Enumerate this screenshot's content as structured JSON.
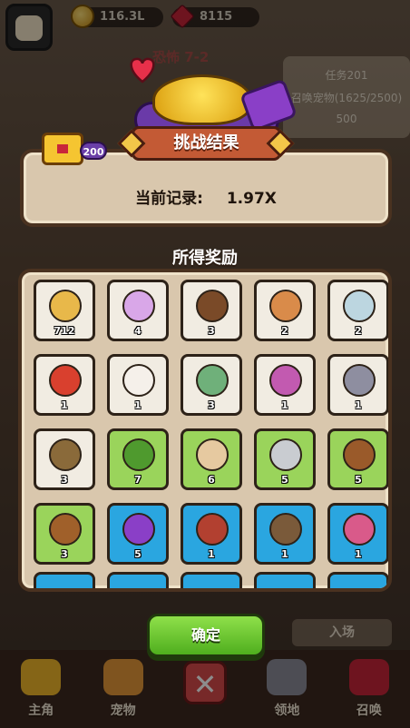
{
  "hud": {
    "gold": "116.3L",
    "gems": "8115",
    "stage": "恐怖 7-2"
  },
  "quest": {
    "title": "任务201",
    "desc": "召唤宠物(1625/2500)",
    "reward": "500"
  },
  "background_enter": "入场",
  "chest_badge": "200",
  "dialog": {
    "title": "挑战结果",
    "record_label": "当前记录:",
    "record_value": "1.97X",
    "rewards_title": "所得奖励",
    "confirm": "确定"
  },
  "rewards": [
    {
      "name": "green-gem-hexagon",
      "count": "712",
      "rarity": "white",
      "color": "#e8b84a"
    },
    {
      "name": "pink-shell",
      "count": "4",
      "rarity": "white",
      "color": "#d9a7e8"
    },
    {
      "name": "coconut",
      "count": "3",
      "rarity": "white",
      "color": "#7a4a28"
    },
    {
      "name": "cracked-egg",
      "count": "2",
      "rarity": "white",
      "color": "#d98b4a"
    },
    {
      "name": "swirl-egg",
      "count": "2",
      "rarity": "white",
      "color": "#bcd6e0"
    },
    {
      "name": "red-dragon",
      "count": "1",
      "rarity": "white",
      "color": "#d9402e"
    },
    {
      "name": "ghost-lollipop",
      "count": "1",
      "rarity": "white",
      "color": "#f5f0ea"
    },
    {
      "name": "green-fish",
      "count": "3",
      "rarity": "white",
      "color": "#6fb07a"
    },
    {
      "name": "purple-bird",
      "count": "1",
      "rarity": "white",
      "color": "#c25ab0"
    },
    {
      "name": "grey-mouse",
      "count": "1",
      "rarity": "white",
      "color": "#8e8ea0"
    },
    {
      "name": "snail",
      "count": "3",
      "rarity": "white",
      "color": "#8a6a3a"
    },
    {
      "name": "green-swirl-ball",
      "count": "7",
      "rarity": "green",
      "color": "#4f9a2e"
    },
    {
      "name": "feather",
      "count": "6",
      "rarity": "green",
      "color": "#e6c9a0"
    },
    {
      "name": "silver-shield",
      "count": "5",
      "rarity": "green",
      "color": "#c9ccd1"
    },
    {
      "name": "wooden-wheel",
      "count": "5",
      "rarity": "green",
      "color": "#9a5a2a"
    },
    {
      "name": "treasure-box",
      "count": "3",
      "rarity": "green",
      "color": "#a0602a"
    },
    {
      "name": "purple-bat",
      "count": "5",
      "rarity": "blue",
      "color": "#8a3fc7"
    },
    {
      "name": "red-warrior",
      "count": "1",
      "rarity": "blue",
      "color": "#b24030"
    },
    {
      "name": "mask-warrior",
      "count": "1",
      "rarity": "blue",
      "color": "#7a5a3a"
    },
    {
      "name": "pink-bunny",
      "count": "1",
      "rarity": "blue",
      "color": "#d95a8a"
    }
  ],
  "nav": [
    {
      "label": "主角",
      "icon": "crown-icon",
      "color": "#f2b92a"
    },
    {
      "label": "宠物",
      "icon": "cat-icon",
      "color": "#e89a3a"
    },
    {
      "label": "",
      "icon": "close-icon",
      "color": "#d94b4b"
    },
    {
      "label": "领地",
      "icon": "castle-icon",
      "color": "#8c8c9a"
    },
    {
      "label": "召唤",
      "icon": "portal-icon",
      "color": "#c9263a"
    }
  ]
}
